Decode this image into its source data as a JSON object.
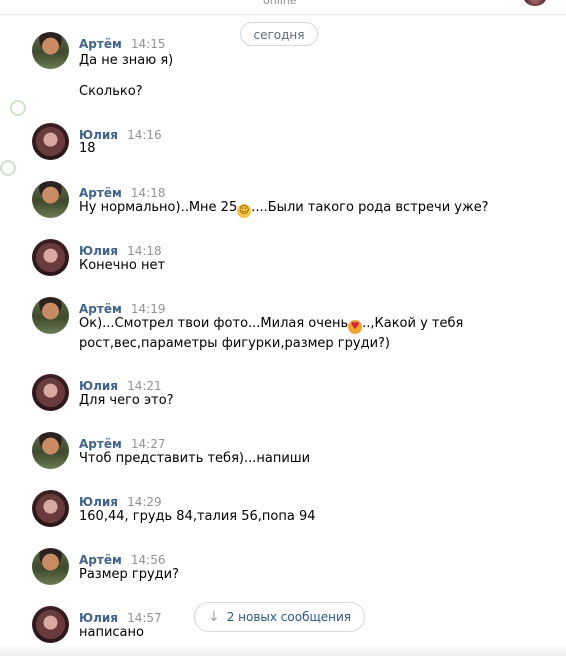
{
  "header": {
    "status": "online"
  },
  "date_separator": "сегодня",
  "messages": [
    {
      "author": "Артём",
      "time": "14:15",
      "lines": [
        "Да не знаю я)",
        "Сколько?"
      ]
    },
    {
      "author": "Юлия",
      "time": "14:16",
      "lines": [
        "18"
      ]
    },
    {
      "author": "Артём",
      "time": "14:18",
      "line_parts": [
        "Ну нормально)..Мне 25",
        "....Были такого рода встречи уже?"
      ]
    },
    {
      "author": "Юлия",
      "time": "14:18",
      "lines": [
        "Конечно нет"
      ]
    },
    {
      "author": "Артём",
      "time": "14:19",
      "line_parts": [
        "Ок)...Смотрел твои фото...Милая очень",
        "..,Какой у тебя"
      ],
      "lines": [
        "рост,вес,параметры фигурки,размер груди?)"
      ]
    },
    {
      "author": "Юлия",
      "time": "14:21",
      "lines": [
        "Для чего это?"
      ]
    },
    {
      "author": "Артём",
      "time": "14:27",
      "lines": [
        "Чтоб представить тебя)...напиши"
      ]
    },
    {
      "author": "Юлия",
      "time": "14:29",
      "lines": [
        "160,44, грудь 84,талия 56,попа 94"
      ]
    },
    {
      "author": "Артём",
      "time": "14:56",
      "lines": [
        "Размер груди?"
      ]
    },
    {
      "author": "Юлия",
      "time": "14:57",
      "lines": [
        "написано"
      ]
    }
  ],
  "new_messages_button": "2 новых сообщения",
  "icons": {
    "emoji_smile": "smiling-face-icon",
    "emoji_hearts": "heart-eyes-face-icon",
    "arrow": "arrow-down-icon"
  }
}
